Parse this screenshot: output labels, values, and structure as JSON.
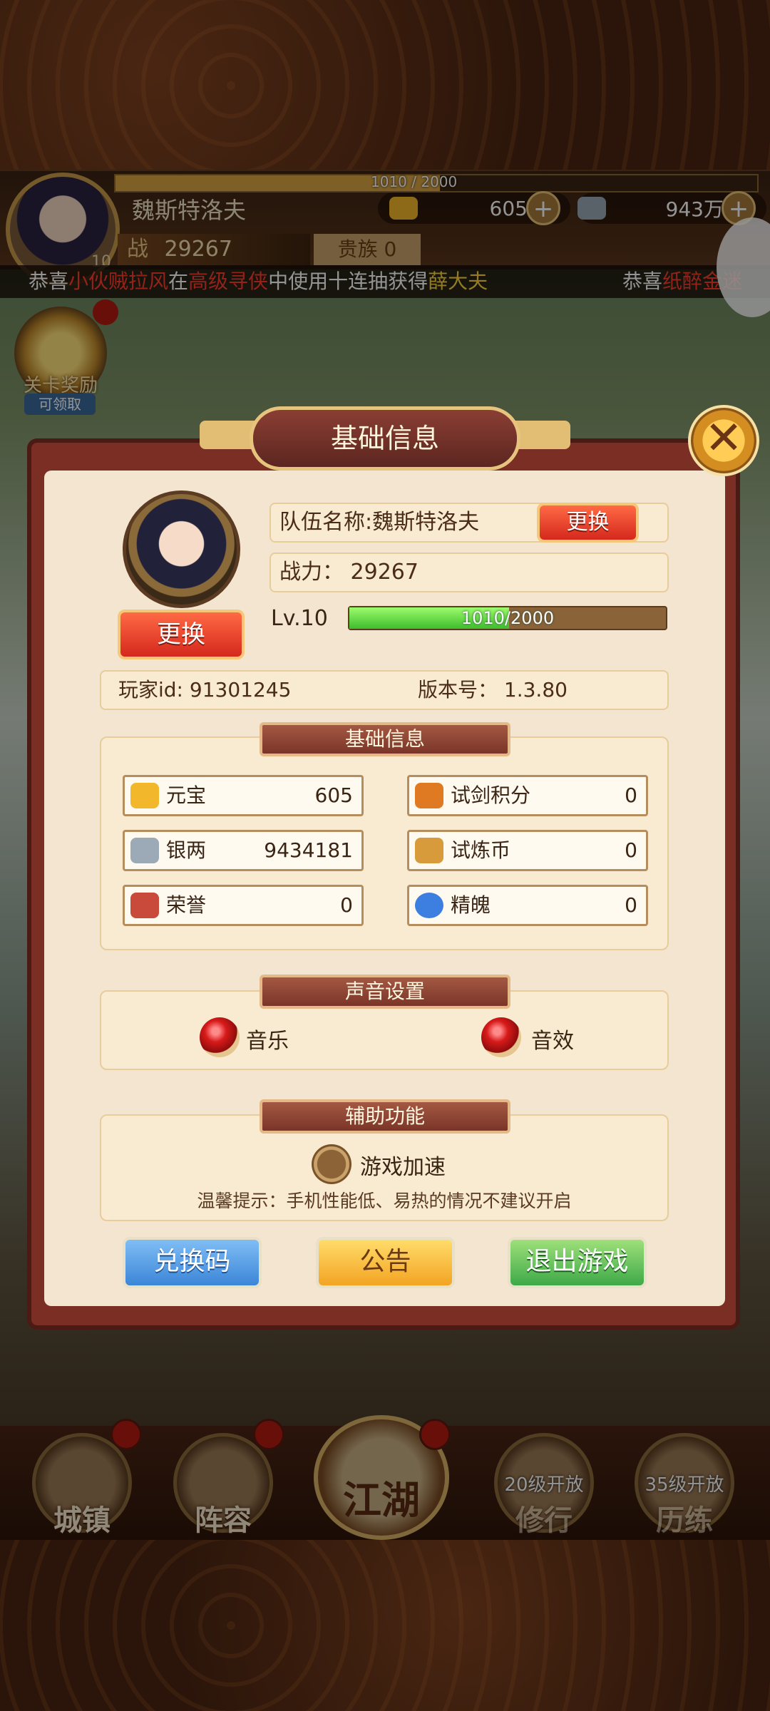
{
  "hud": {
    "player_name": "魏斯特洛夫",
    "exp_text": "1010 / 2000",
    "exp_fraction": 0.505,
    "gold": "605",
    "silver": "943万",
    "power_tag": "战",
    "power": "29267",
    "noble": "贵族 0",
    "small_level": "10"
  },
  "marquee": {
    "parts": [
      "恭喜",
      "小伙贼拉风",
      "在",
      "高级寻侠",
      "中使用十连抽获得",
      "薛大夫"
    ],
    "second": [
      "恭喜",
      "纸醉金迷"
    ]
  },
  "reward": {
    "label": "关卡奖励",
    "sub": "可领取"
  },
  "modal": {
    "title": "基础信息",
    "close_icon": "close-x-icon",
    "team_name": "队伍名称:魏斯特洛夫",
    "change_label": "更换",
    "power_row": "战力：  29267",
    "level_label": "Lv.10",
    "level_progress_text": "1010/2000",
    "level_fraction": 0.505,
    "player_id": "玩家id: 91301245",
    "version": "版本号：  1.3.80",
    "sections": {
      "basic": "基础信息",
      "sound": "声音设置",
      "assist": "辅助功能"
    },
    "resources": [
      {
        "name": "元宝",
        "value": "605",
        "icon": "gold-ingot-icon",
        "color": "#f2b72a"
      },
      {
        "name": "银两",
        "value": "9434181",
        "icon": "silver-ingot-icon",
        "color": "#9ca9b6"
      },
      {
        "name": "荣誉",
        "value": "0",
        "icon": "honor-icon",
        "color": "#c94a3a"
      },
      {
        "name": "试剑积分",
        "value": "0",
        "icon": "sword-trial-icon",
        "color": "#e07a22"
      },
      {
        "name": "试炼币",
        "value": "0",
        "icon": "trial-coin-icon",
        "color": "#d79b3c"
      },
      {
        "name": "精魄",
        "value": "0",
        "icon": "spirit-icon",
        "color": "#3c7fe0"
      }
    ],
    "sound": {
      "music": "音乐",
      "effect": "音效"
    },
    "assist": {
      "speed": "游戏加速",
      "tip": "温馨提示：手机性能低、易热的情况不建议开启"
    },
    "buttons": {
      "redeem": "兑换码",
      "notice": "公告",
      "quit": "退出游戏"
    }
  },
  "nav": {
    "town": "城镇",
    "lineup": "阵容",
    "jianghu": "江湖",
    "cultivate": "修行",
    "cultivate_lock": "20级开放",
    "train": "历练",
    "train_lock": "35级开放"
  }
}
